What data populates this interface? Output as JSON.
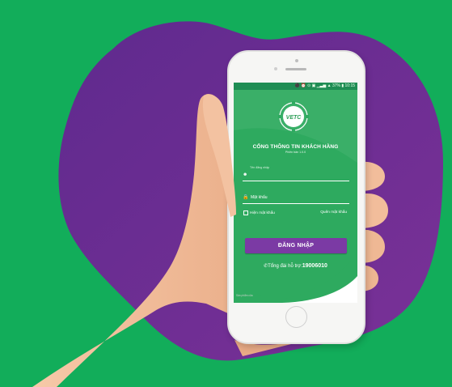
{
  "status_bar": {
    "text": "⚫ ⏰ ⊙ ▣ ▁▃▅ ▲ 37% ▮ 10:15"
  },
  "app": {
    "logo_text": "VETC",
    "title": "CỔNG THÔNG TIN KHÁCH HÀNG",
    "version": "Phiên bản 1.0.0",
    "username_label": "Tên đăng nhập",
    "password_label": "Mật khẩu",
    "show_password_label": "Hiện mật khẩu",
    "forgot_password_label": "Quên mật khẩu",
    "login_button": "ĐĂNG NHẬP",
    "hotline_prefix": "Tổng đài hỗ trợ:",
    "hotline_number": "19006010",
    "footer_prefix": "Sản phẩm của",
    "footer_brand": "VETC"
  },
  "colors": {
    "background_green": "#12ad5a",
    "blob_purple": "#6b2d92",
    "app_green": "#2eaa5f",
    "button_purple": "#7b3aa4"
  }
}
